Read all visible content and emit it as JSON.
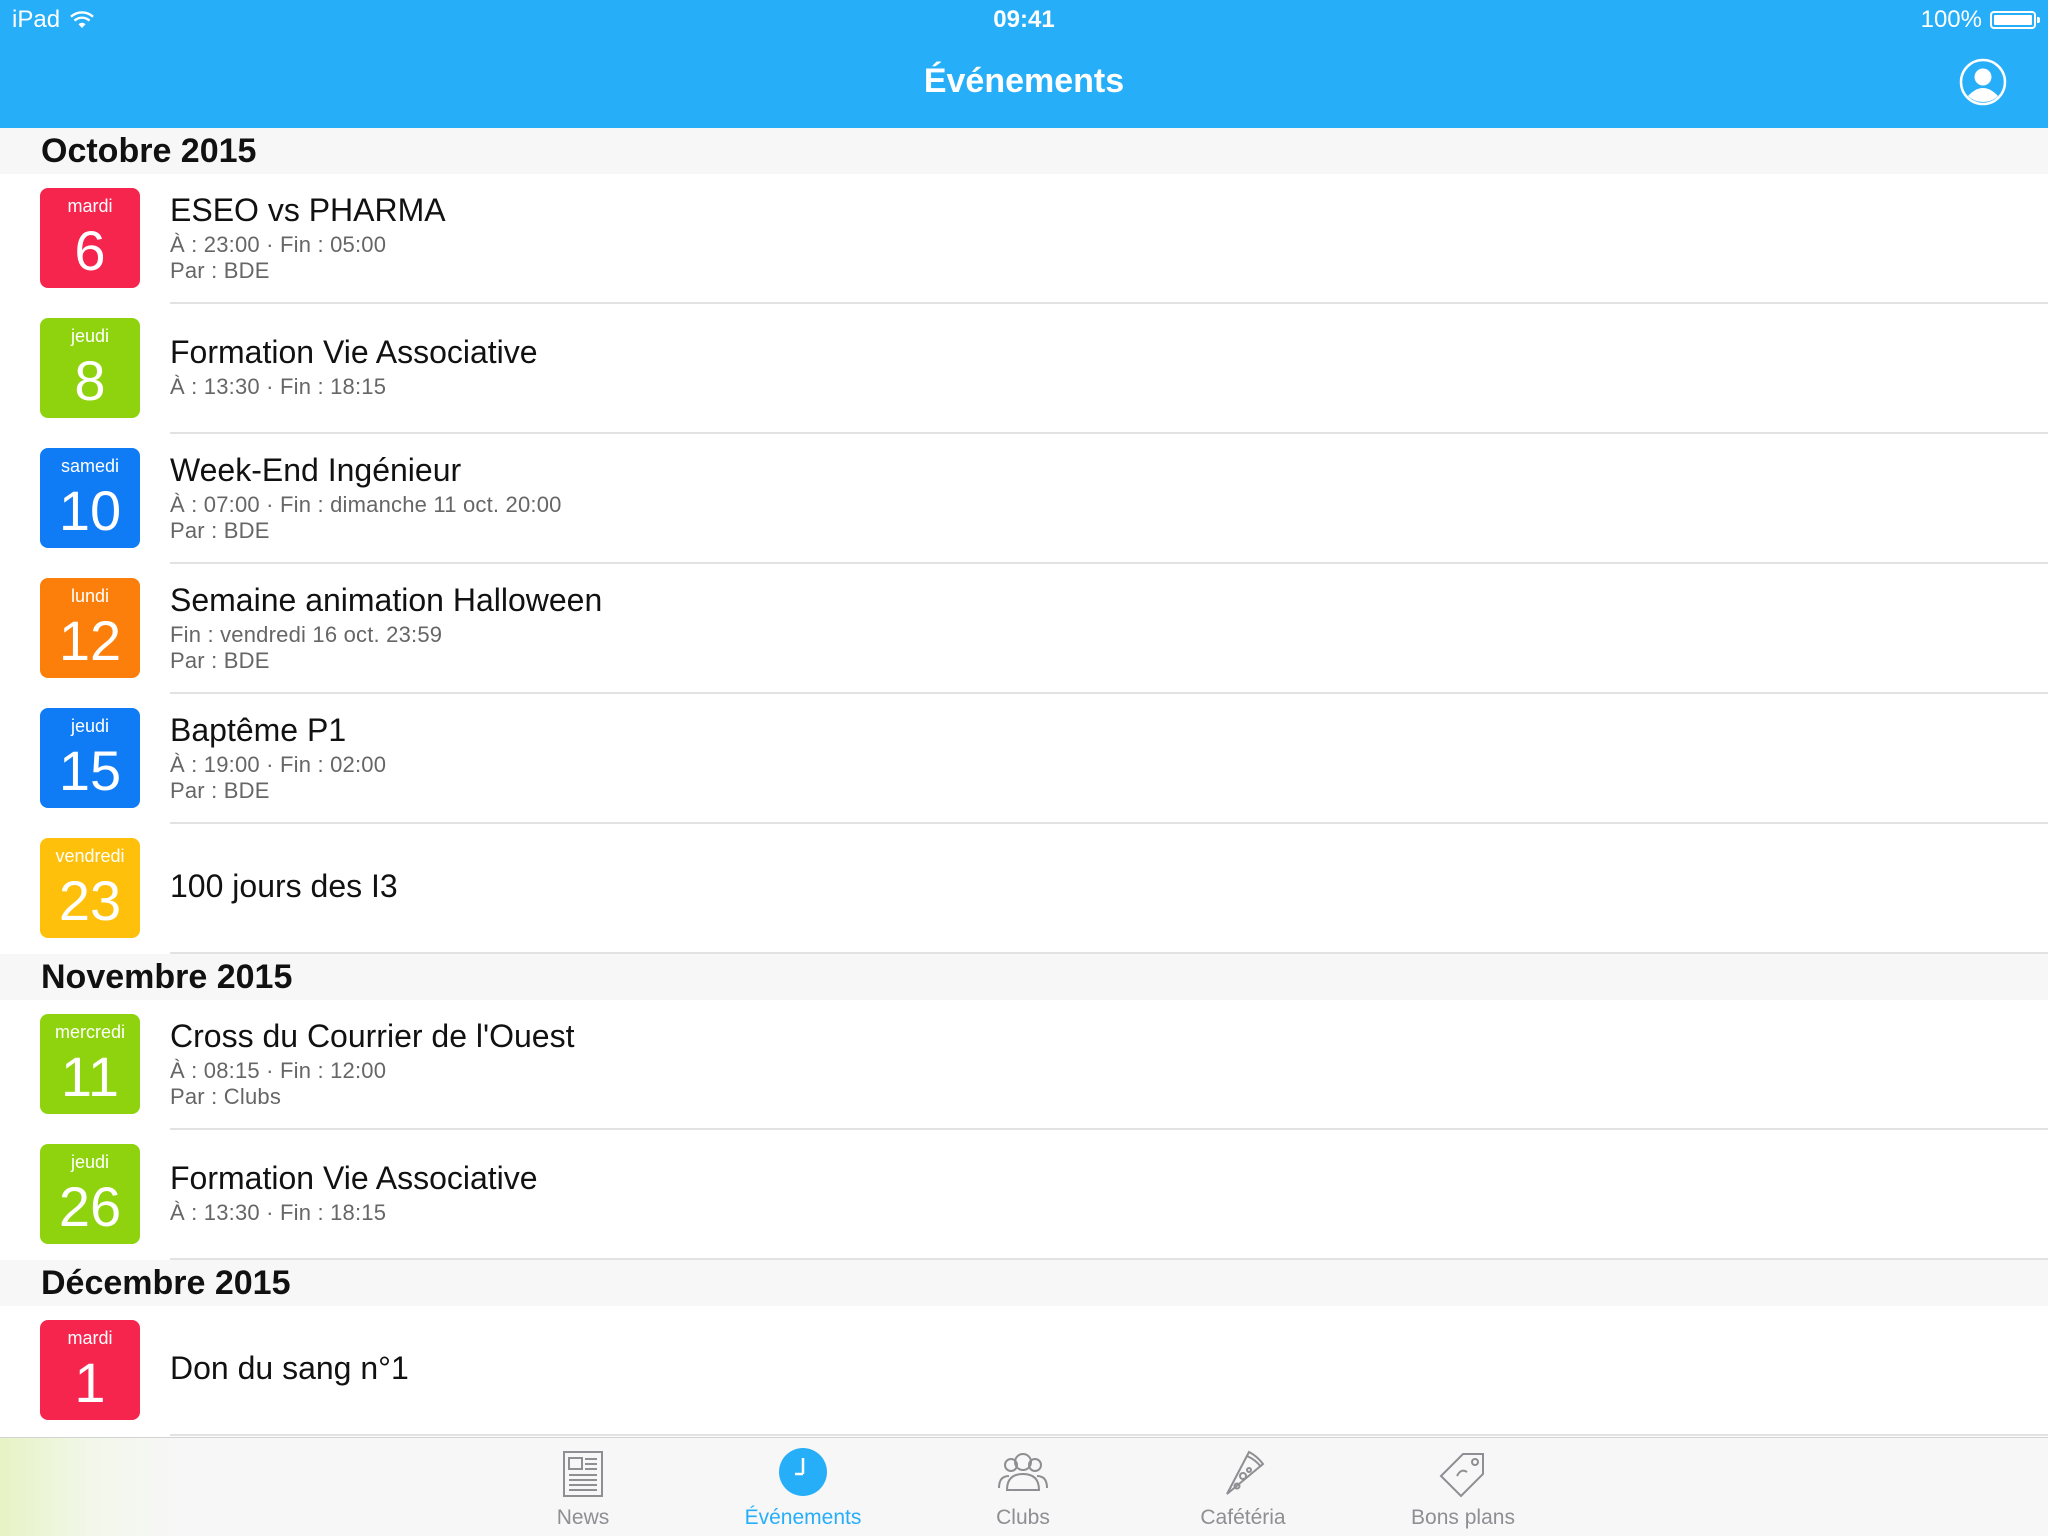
{
  "status_bar": {
    "device": "iPad",
    "time": "09:41",
    "battery": "100%"
  },
  "nav": {
    "title": "Événements",
    "profile_icon": "user-avatar-icon"
  },
  "colors": {
    "header": "#27aef9",
    "red": "#f6254d",
    "green": "#8fd30e",
    "blue": "#0f7bf5",
    "orange": "#fc7f0c",
    "yellow": "#fec00a"
  },
  "sections": [
    {
      "title": "Octobre 2015",
      "events": [
        {
          "day": "mardi",
          "num": "6",
          "color": "#f6254d",
          "title": "ESEO vs PHARMA",
          "times": "À : 23:00  ·  Fin : 05:00",
          "by": "Par : BDE"
        },
        {
          "day": "jeudi",
          "num": "8",
          "color": "#8fd30e",
          "title": "Formation Vie Associative",
          "times": "À : 13:30  ·  Fin : 18:15",
          "by": ""
        },
        {
          "day": "samedi",
          "num": "10",
          "color": "#0f7bf5",
          "title": "Week-End Ingénieur",
          "times": "À : 07:00  ·  Fin : dimanche 11 oct. 20:00",
          "by": "Par : BDE"
        },
        {
          "day": "lundi",
          "num": "12",
          "color": "#fc7f0c",
          "title": "Semaine animation Halloween",
          "times": "Fin : vendredi 16 oct. 23:59",
          "by": "Par : BDE"
        },
        {
          "day": "jeudi",
          "num": "15",
          "color": "#0f7bf5",
          "title": "Baptême P1",
          "times": "À : 19:00  ·  Fin : 02:00",
          "by": "Par : BDE"
        },
        {
          "day": "vendredi",
          "num": "23",
          "color": "#fec00a",
          "title": "100 jours des I3",
          "times": "",
          "by": ""
        }
      ]
    },
    {
      "title": "Novembre 2015",
      "events": [
        {
          "day": "mercredi",
          "num": "11",
          "color": "#8fd30e",
          "title": "Cross du Courrier de l'Ouest",
          "times": "À : 08:15  ·  Fin : 12:00",
          "by": "Par : Clubs"
        },
        {
          "day": "jeudi",
          "num": "26",
          "color": "#8fd30e",
          "title": "Formation Vie Associative",
          "times": "À : 13:30  ·  Fin : 18:15",
          "by": ""
        }
      ]
    },
    {
      "title": "Décembre 2015",
      "events": [
        {
          "day": "mardi",
          "num": "1",
          "color": "#f6254d",
          "title": "Don du sang n°1",
          "times": "",
          "by": ""
        }
      ]
    }
  ],
  "tabs": [
    {
      "label": "News",
      "icon": "newspaper-icon",
      "active": false
    },
    {
      "label": "Événements",
      "icon": "clock-icon",
      "active": true
    },
    {
      "label": "Clubs",
      "icon": "people-icon",
      "active": false
    },
    {
      "label": "Cafétéria",
      "icon": "pizza-icon",
      "active": false
    },
    {
      "label": "Bons plans",
      "icon": "price-tag-icon",
      "active": false
    }
  ]
}
